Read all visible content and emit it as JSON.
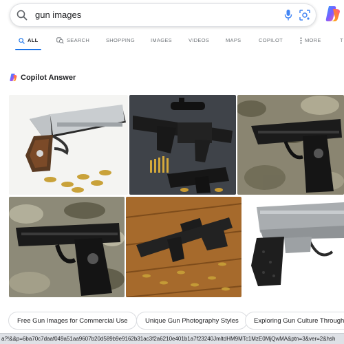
{
  "search": {
    "query": "gun images"
  },
  "tabs": [
    {
      "label": "ALL",
      "icon": "search-icon",
      "active": true
    },
    {
      "label": "SEARCH",
      "icon": "copilot-search-icon"
    },
    {
      "label": "SHOPPING"
    },
    {
      "label": "IMAGES"
    },
    {
      "label": "VIDEOS"
    },
    {
      "label": "MAPS"
    },
    {
      "label": "COPILOT"
    },
    {
      "label": "MORE",
      "icon": "more-vert-icon"
    },
    {
      "label": "T"
    }
  ],
  "answer": {
    "title": "Copilot Answer"
  },
  "images": [
    {
      "name": "silver-pistol-with-bullets"
    },
    {
      "name": "black-rifle-with-scope"
    },
    {
      "name": "black-pistol-on-camo"
    },
    {
      "name": "black-pistol-on-camo-2"
    },
    {
      "name": "rifle-on-wooden-planks"
    },
    {
      "name": "silver-pistol-on-white"
    }
  ],
  "chips": [
    "Free Gun Images for Commercial Use",
    "Unique Gun Photography Styles",
    "Exploring Gun Culture Through"
  ],
  "status": {
    "url": "a?!&&p=6ba70c7daaf049a51aa9607b20d589b9e9162b31ac3f2a6210e401b1a7f23240JmltdHM9MTc1MzE0MjQwMA&ptn=3&ver=2&hsh"
  },
  "colors": {
    "accent": "#1a73e8",
    "chip_border": "#dadce0"
  }
}
